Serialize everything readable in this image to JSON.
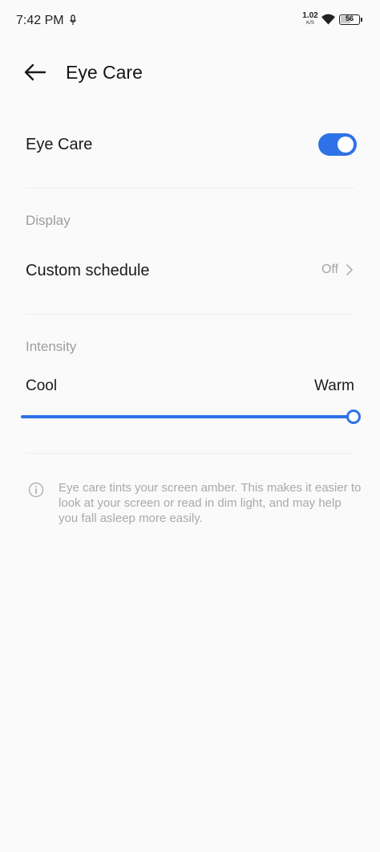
{
  "status_bar": {
    "time": "7:42 PM",
    "net_speed_value": "1.02",
    "net_speed_unit": "K/S",
    "battery_level": "56",
    "icons": [
      "mic-icon",
      "wifi-icon",
      "battery-icon"
    ]
  },
  "header": {
    "title": "Eye Care",
    "back_icon": "arrow-left-icon"
  },
  "eye_care_row": {
    "label": "Eye Care",
    "toggle_on": true
  },
  "display_section": {
    "title": "Display"
  },
  "custom_schedule_row": {
    "label": "Custom schedule",
    "value": "Off",
    "icon": "chevron-right-icon"
  },
  "intensity_section": {
    "title": "Intensity",
    "min_label": "Cool",
    "max_label": "Warm",
    "level_percent": 100
  },
  "info": {
    "icon": "info-icon",
    "text": "Eye care tints your screen amber. This makes it easier to look at your screen or read in dim light, and may help you fall asleep more easily."
  },
  "colors": {
    "accent": "#2f72e8",
    "background": "#fafafb",
    "secondary_text": "#9c9c9c"
  }
}
